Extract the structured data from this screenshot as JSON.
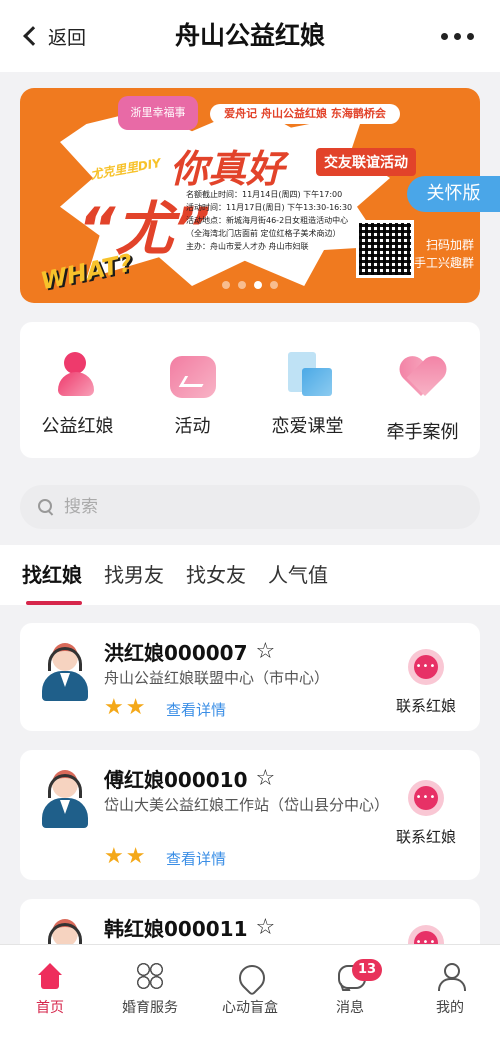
{
  "navbar": {
    "back_label": "返回",
    "title": "舟山公益红娘"
  },
  "banner": {
    "logo_text": "浙里幸福事",
    "subheading": "爱舟记  舟山公益红娘  东海鹊桥会",
    "tagline": "尤克里里DIY",
    "headline": "你真好",
    "event_tag": "交友联谊活动",
    "big_word": "“尤”",
    "what_text": "WHAT?",
    "details": [
      "名额截止时间：11月14日(周四) 下午17:00",
      "活动时间：11月17日(周日) 下午13:30-16:30",
      "活动地点：新城海月街46-2日女粗造活动中心",
      "（全海湾北门店面前 定位红格子美术商边）",
      "主办：舟山市爱人才办 舟山市妇联"
    ],
    "scan_lines": [
      "扫码加群",
      "手工兴趣群"
    ],
    "care_badge": "关怀版",
    "slide_count": 4,
    "active_slide": 3
  },
  "quick_entries": [
    {
      "label": "公益红娘",
      "icon": "matchmaker-person-icon"
    },
    {
      "label": "活动",
      "icon": "activity-chart-icon"
    },
    {
      "label": "恋爱课堂",
      "icon": "love-class-book-icon"
    },
    {
      "label": "牵手案例",
      "icon": "heart-case-icon"
    }
  ],
  "search": {
    "placeholder": "搜索"
  },
  "tabs": [
    {
      "label": "找红娘",
      "active": true
    },
    {
      "label": "找男友",
      "active": false
    },
    {
      "label": "找女友",
      "active": false
    },
    {
      "label": "人气值",
      "active": false
    }
  ],
  "matchmakers": [
    {
      "name": "洪红娘000007",
      "org": "舟山公益红娘联盟中心（市中心）",
      "stars": 2,
      "detail_link": "查看详情",
      "contact_label": "联系红娘"
    },
    {
      "name": "傅红娘000010",
      "org": "岱山大美公益红娘工作站（岱山县分中心）",
      "stars": 2,
      "detail_link": "查看详情",
      "contact_label": "联系红娘"
    },
    {
      "name": "韩红娘000011",
      "org": "",
      "stars": 0,
      "detail_link": "",
      "contact_label": ""
    }
  ],
  "tabbar": [
    {
      "label": "首页",
      "icon": "home-icon",
      "active": true
    },
    {
      "label": "婚育服务",
      "icon": "clover-icon",
      "active": false
    },
    {
      "label": "心动盲盒",
      "icon": "heart-box-icon",
      "active": false
    },
    {
      "label": "消息",
      "icon": "message-icon",
      "active": false,
      "badge": "13"
    },
    {
      "label": "我的",
      "icon": "user-icon",
      "active": false
    }
  ],
  "colors": {
    "accent": "#d6264b",
    "banner_orange": "#f07a1f",
    "link_blue": "#3a8ee6",
    "star_gold": "#f4a818",
    "care_blue": "#4aa6e8"
  }
}
